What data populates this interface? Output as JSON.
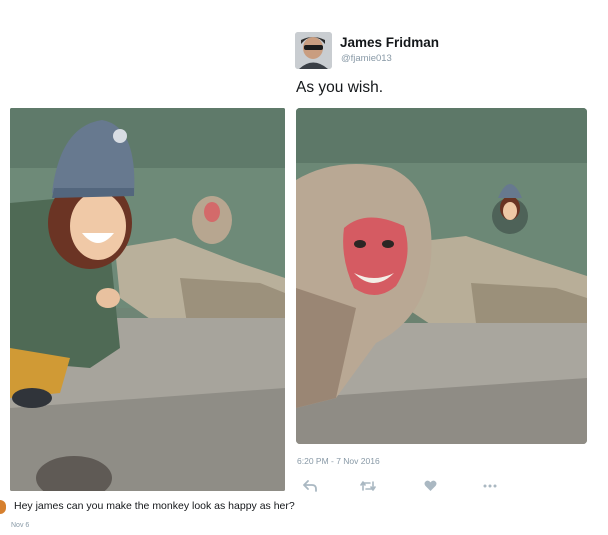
{
  "original_post": {
    "request_text": "Hey james can you make the monkey look as happy as her?",
    "date": "Nov 6",
    "photo_alt": "Smiling woman in a knit hat taking a selfie with a monkey in a hot spring behind her"
  },
  "reply": {
    "author_name": "James Fridman",
    "author_handle": "@fjamie013",
    "text": "As you wish.",
    "photo_alt": "Grinning monkey in the foreground taking a selfie with the woman in the hot spring behind",
    "timestamp": "6:20 PM - 7 Nov 2016",
    "actions": [
      {
        "name": "reply-icon"
      },
      {
        "name": "retweet-icon"
      },
      {
        "name": "like-icon"
      },
      {
        "name": "more-icon"
      }
    ]
  },
  "colors": {
    "text_primary": "#14171a",
    "text_secondary": "#8899a6",
    "icon_gray": "#aab8c2"
  }
}
